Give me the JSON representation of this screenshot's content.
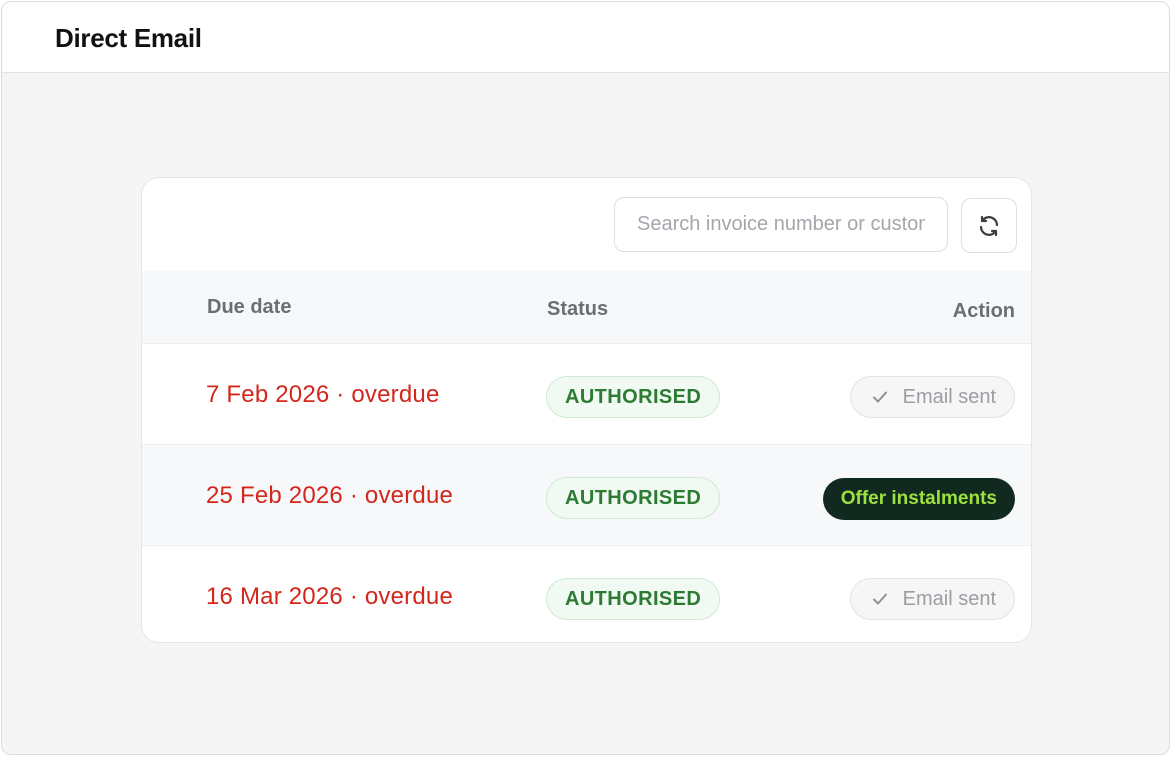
{
  "header": {
    "title": "Direct Email"
  },
  "toolbar": {
    "search_placeholder": "Search invoice number or customer",
    "refresh_icon": "refresh-icon"
  },
  "table": {
    "columns": {
      "due_date": "Due date",
      "status": "Status",
      "action": "Action"
    },
    "rows": [
      {
        "due": "7 Feb 2026 · overdue",
        "status": "AUTHORISED",
        "action": "Email sent",
        "action_type": "sent"
      },
      {
        "due": "25 Feb 2026 · overdue",
        "status": "AUTHORISED",
        "action": "Offer instalments",
        "action_type": "offer"
      },
      {
        "due": "16 Mar 2026 · overdue",
        "status": "AUTHORISED",
        "action": "Email sent",
        "action_type": "sent"
      }
    ]
  },
  "colors": {
    "overdue": "#d3271b",
    "status_text": "#2d7a33",
    "status_bg": "#f1faf2",
    "offer_bg": "#11291f",
    "offer_text": "#9be23c"
  }
}
